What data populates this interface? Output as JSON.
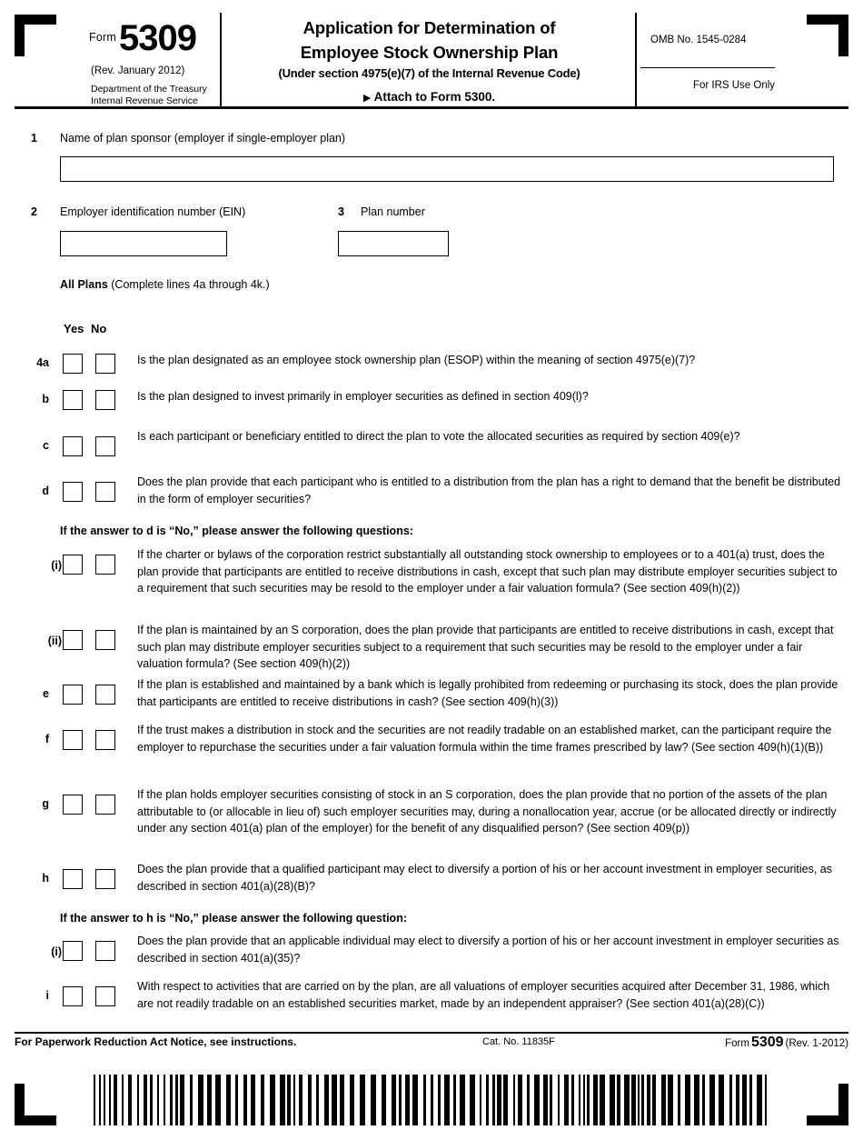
{
  "header": {
    "form_label": "Form",
    "form_number": "5309",
    "revision": "(Rev. January 2012)",
    "department_line1": "Department of the Treasury",
    "department_line2": "Internal Revenue Service",
    "title_line1": "Application for Determination of",
    "title_line2": "Employee Stock Ownership Plan",
    "subtitle": "(Under section 4975(e)(7) of the Internal Revenue Code)",
    "attach_arrow": "▶",
    "attach_text": "Attach to Form 5300.",
    "omb": "OMB No. 1545-0284",
    "irs_use_only": "For IRS Use Only"
  },
  "fields": {
    "line1_num": "1",
    "line1_label": "Name of plan sponsor (employer if single-employer plan)",
    "line1_value": "",
    "line2_num": "2",
    "line2_label": "Employer identification number (EIN)",
    "line2_value": "",
    "line3_num": "3",
    "line3_label": "Plan number",
    "line3_value": ""
  },
  "all_plans": {
    "bold": "All Plans",
    "rest": " (Complete lines 4a through 4k.)"
  },
  "columns": {
    "yes": "Yes",
    "no": "No"
  },
  "questions": [
    {
      "label": "4a",
      "text": "Is the plan designated as an employee stock ownership plan (ESOP) within the meaning of section 4975(e)(7)?"
    },
    {
      "label": "b",
      "text": "Is the plan designed to invest primarily in employer securities as defined in section 409(l)?"
    },
    {
      "label": "c",
      "text": "Is each participant or beneficiary entitled to direct the plan to vote the allocated securities as required by section 409(e)?"
    },
    {
      "label": "d",
      "text": "Does the plan provide that each participant who is entitled to a distribution from the plan has a right to demand that the benefit be distributed in the form of employer securities?"
    },
    {
      "label": "(i)",
      "text": "If the charter or bylaws of the corporation restrict substantially all outstanding stock ownership to employees or to a 401(a) trust, does the plan provide that participants are entitled to receive distributions in cash, except that such plan may distribute employer securities subject to a requirement that such securities may be resold to the employer under a fair valuation formula? (See section 409(h)(2))"
    },
    {
      "label": "(ii)",
      "text": "If the plan is maintained by an S corporation, does the plan provide that participants are entitled to receive distributions in cash, except that such plan may distribute employer securities subject to a requirement that such securities may be resold to the employer under a fair valuation formula? (See section 409(h)(2))"
    },
    {
      "label": "e",
      "text": "If the plan is established and maintained by a bank which is legally prohibited from redeeming or purchasing its stock, does the plan provide that participants are entitled to receive distributions in cash? (See section 409(h)(3))"
    },
    {
      "label": "f",
      "text": "If the trust makes a distribution in stock and the securities are not readily tradable on an established market, can the participant require the employer to repurchase the securities under a fair valuation formula within the time frames prescribed by law? (See section 409(h)(1)(B))"
    },
    {
      "label": "g",
      "text": "If the plan holds employer securities consisting of stock in an S corporation, does the plan provide that no portion of the assets of the plan attributable to (or allocable in lieu of) such employer securities may, during a nonallocation year, accrue (or be allocated directly or indirectly under any section 401(a) plan of the employer) for the benefit of any disqualified person? (See section 409(p))"
    },
    {
      "label": "h",
      "text": "Does the plan provide that a qualified participant may elect to diversify a portion of his or her account investment in employer securities, as described in section 401(a)(28)(B)?"
    },
    {
      "label": "(i)",
      "text": "Does the plan provide that an applicable individual may elect to diversify a portion of his or her account investment in employer securities as described in section 401(a)(35)?"
    },
    {
      "label": "i",
      "text": "With respect to activities that are carried on by the plan, are all valuations of employer securities acquired after December 31, 1986, which are not readily tradable on an established securities market, made by an independent appraiser? (See section 401(a)(28)(C))"
    }
  ],
  "subheadings": {
    "after_d": "If the answer to d is “No,” please answer the following questions:",
    "after_h": "If the answer to h is “No,” please answer the following question:"
  },
  "footer": {
    "paperwork": "For Paperwork Reduction Act Notice, see instructions.",
    "cat_no": "Cat. No. 11835F",
    "form_word": "Form",
    "form_number": "5309",
    "form_rev": "(Rev. 1-2012)"
  }
}
